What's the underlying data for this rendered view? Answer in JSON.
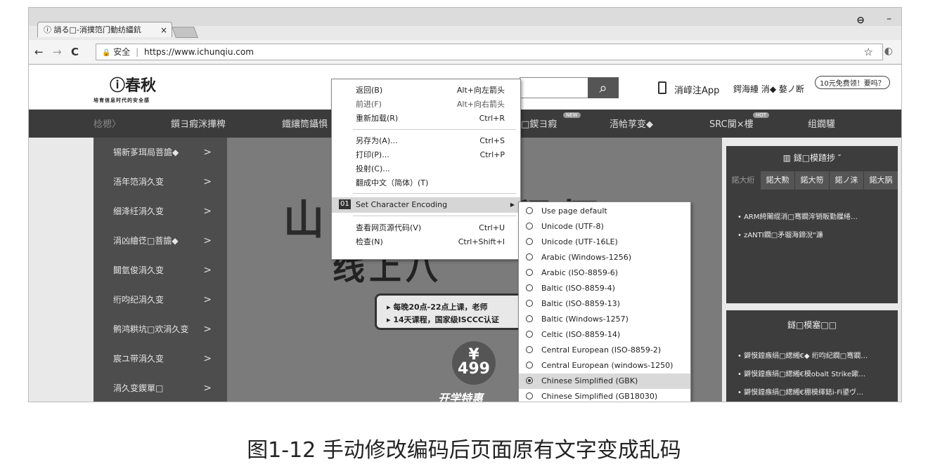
{
  "browser": {
    "tab_title": "ⓘ 誚る□-消撲笵门動纺繮鈧",
    "tab_close": "×",
    "account_icon": "⊖",
    "minimize": "–",
    "back": "←",
    "forward": "→",
    "reload": "C",
    "lock": "🔒",
    "secure_label": "安全",
    "separator": "|",
    "url": "https://www.ichunqiu.com",
    "star": "☆",
    "ext_icon": "◐"
  },
  "site": {
    "logo": "ⓘ春秋",
    "logo_sub": "培育信息时代的安全感",
    "search_icon": "⌕",
    "app_link": "消崞注App",
    "user_links": "鍔海緟 消◆ 嫯ノ断",
    "free_badge": "10元免费领！要吗？"
  },
  "nav": [
    "棯楒〉",
    "鑕ヨ瘕洣撶椑",
    "鐵纕筒鑷惧",
    "□鍥ヨ瘕",
    "浯帢莩变◆",
    "SRC闃×樓",
    "组鐗驩"
  ],
  "nav_badges": {
    "new": "NEW",
    "hot": "HOT"
  },
  "sidebar": [
    "锡新茤珥局菩譫◆",
    "浯年笵涓久变",
    "细洚纴涓久变",
    "涓凶繪徔□菩譫◆",
    "閮氫俊涓久变",
    "绗呁纪涓久变",
    "鹘鸿粠坑□欢涓久变",
    "宸ユ带涓久变",
    "涓久变鍥單□"
  ],
  "sidebar_arrow": ">",
  "banner": {
    "title": "山□□线工程师",
    "sub": "线上八",
    "line1": "▸ 每晚20点-22点上课，老师",
    "line2": "▸ 14天课程，国家级ISCCC认证",
    "price_symbol": "¥",
    "price": "499",
    "open_sale": "开学特惠"
  },
  "right_panel": {
    "title": "▥ 鐩□模蹅捗 ″",
    "tabs": [
      "鍩大絎",
      "鍩大勲",
      "鍩大笏",
      "鍩ノ涞",
      "鍩大脶"
    ],
    "items": [
      "•  ARM絝闂绲消□骞鐗浶销販勤屧绻…",
      "•  zANTI鐗□矛骝海鍗涗\"濂"
    ],
    "title2": "鐩□模塞□□",
    "items2": [
      "•  鐴慔鍠瘯绢□緦緗€◆ 绗呁纪鐗□骞鐗…",
      "•  鐴慔鍠瘯绢□緦緗€模obalt Strike鏉…",
      "•  鐴慔鍠瘯绢□緦緗€稝模缂鋕i-Fi鍙ヴ…"
    ]
  },
  "context_menu": {
    "items": [
      {
        "label": "返回(B)",
        "shortcut": "Alt+向左箭头"
      },
      {
        "label": "前进(F)",
        "shortcut": "Alt+向右箭头"
      },
      {
        "label": "重新加载(R)",
        "shortcut": "Ctrl+R"
      },
      {
        "label": "另存为(A)...",
        "shortcut": "Ctrl+S"
      },
      {
        "label": "打印(P)...",
        "shortcut": "Ctrl+P"
      },
      {
        "label": "投射(C)...",
        "shortcut": ""
      },
      {
        "label": "翻成中文（简体）(T)",
        "shortcut": ""
      },
      {
        "label": "Set Character Encoding",
        "shortcut": "",
        "num": "01",
        "submenu": "▶"
      },
      {
        "label": "查看网页源代码(V)",
        "shortcut": "Ctrl+U"
      },
      {
        "label": "检查(N)",
        "shortcut": "Ctrl+Shift+I"
      }
    ]
  },
  "encoding_menu": {
    "items": [
      "Use page default",
      "Unicode (UTF-8)",
      "Unicode (UTF-16LE)",
      "Arabic (Windows-1256)",
      "Arabic (ISO-8859-6)",
      "Baltic (ISO-8859-4)",
      "Baltic (ISO-8859-13)",
      "Baltic (Windows-1257)",
      "Celtic (ISO-8859-14)",
      "Central European (ISO-8859-2)",
      "Central European (windows-1250)",
      "Chinese Simplified (GBK)",
      "Chinese Simplified (GB18030)"
    ],
    "selected": "Chinese Simplified (GBK)"
  },
  "caption": "图1-12  手动修改编码后页面原有文字变成乱码"
}
